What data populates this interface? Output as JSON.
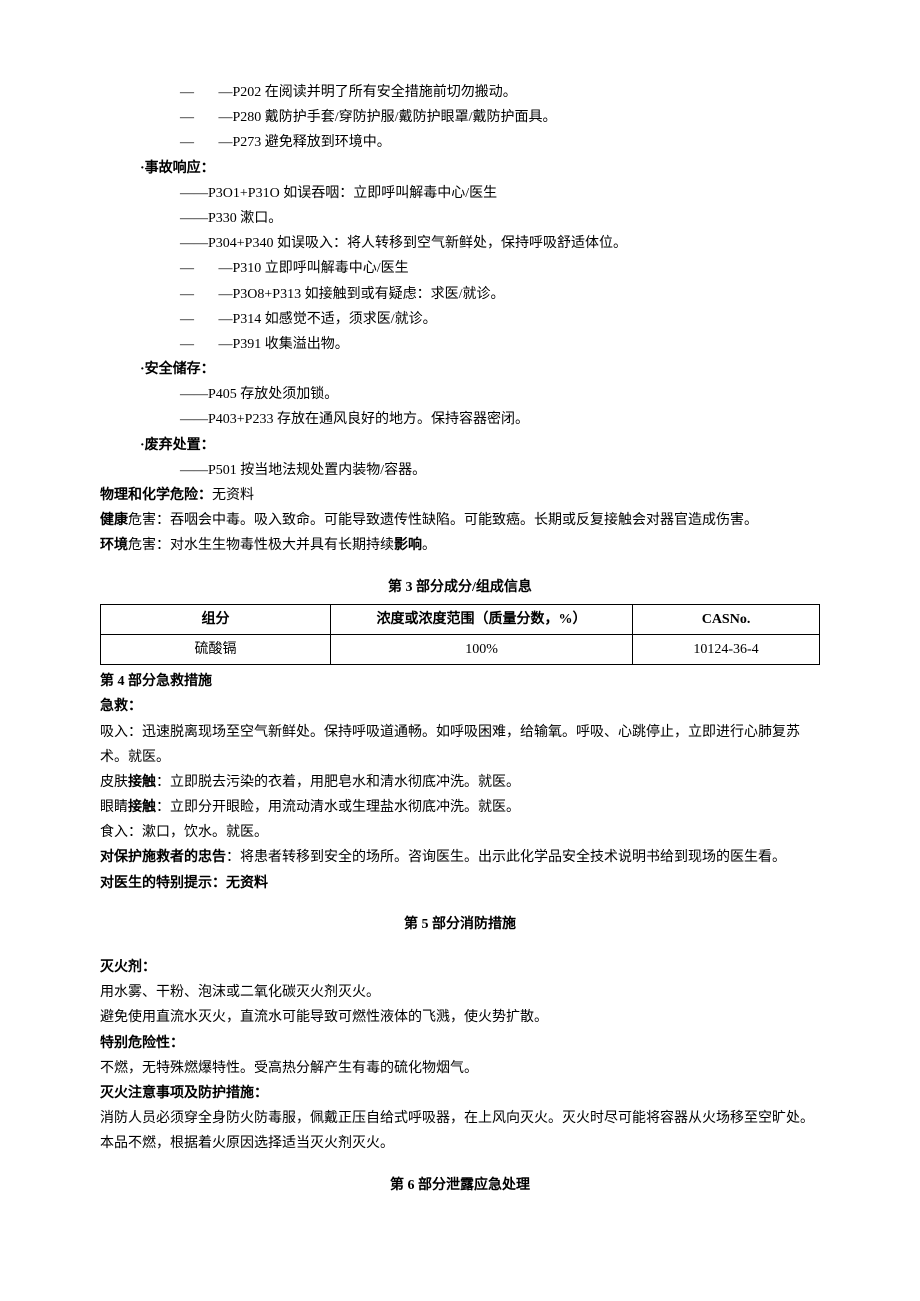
{
  "safety": {
    "p202": "P202 在阅读并明了所有安全措施前切勿搬动。",
    "p280": "P280 戴防护手套/穿防护服/戴防护眼罩/戴防护面具。",
    "p273": "P273 避免释放到环境中。",
    "accident_label": "·事故响应：",
    "p301_310": "P3O1+P31O 如误吞咽：立即呼叫解毒中心/医生",
    "p330": "P330 漱口。",
    "p304_340": "P304+P340 如误吸入：将人转移到空气新鲜处，保持呼吸舒适体位。",
    "p310": "P310 立即呼叫解毒中心/医生",
    "p308_313": "P3O8+P313 如接触到或有疑虑：求医/就诊。",
    "p314": "P314 如感觉不适，须求医/就诊。",
    "p391": "P391 收集溢出物。",
    "storage_label": "·安全储存：",
    "p405": "P405 存放处须加锁。",
    "p403_233": "P403+P233 存放在通风良好的地方。保持容器密闭。",
    "dispose_label": "·废弃处置：",
    "p501": "P501 按当地法规处置内装物/容器。"
  },
  "summary": {
    "phys_label": "物理和化学危险：",
    "phys_text": "无资料",
    "health_label": "健康",
    "health_text": "危害：吞咽会中毒。吸入致命。可能导致遗传性缺陷。可能致癌。长期或反复接触会对器官造成伤害。",
    "env_label": "环境",
    "env_text": "危害：对水生生物毒性极大并具有长期持续",
    "env_bold2": "影响",
    "env_tail": "。"
  },
  "section3": {
    "title": "第 3 部分成分/组成信息",
    "headers": [
      "组分",
      "浓度或浓度范围（质量分数，%）",
      "CASNo."
    ],
    "row": [
      "硫酸镉",
      "100%",
      "10124-36-4"
    ]
  },
  "section4": {
    "title": "第 4 部分急救措施",
    "jijiu": "急救：",
    "xiru": "吸入：迅速脱离现场至空气新鲜处。保持呼吸道通畅。如呼吸困难，给输氧。呼吸、心跳停止，立即进行心肺复苏术。就医。",
    "pifu_pre": "皮肤",
    "pifu_bold": "接触",
    "pifu_post": "：立即脱去污染的衣着，用肥皂水和清水彻底冲洗。就医。",
    "yanjing_pre": "眼睛",
    "yanjing_bold": "接触",
    "yanjing_post": "：立即分开眼睑，用流动清水或生理盐水彻底冲洗。就医。",
    "shiru": "食入：漱口，饮水。就医。",
    "advice_label": "对保护施救者的忠告",
    "advice_text": "：将患者转移到安全的场所。咨询医生。出示此化学品安全技术说明书给到现场的医生看。",
    "doctor_label": "对医生的特别提示：无资料"
  },
  "section5": {
    "title": "第 5 部分消防措施",
    "fire_agent_label": "灭火剂：",
    "fire_agent_text": "用水雾、干粉、泡沫或二氧化碳灭火剂灭火。",
    "avoid": "避免使用直流水灭火，直流水可能导致可燃性液体的飞溅，使火势扩散。",
    "danger_label": "特别危险性：",
    "danger_text": "不燃，无特殊燃爆特性。受高热分解产生有毒的硫化物烟气。",
    "note_label": "灭火注意事项及防护措施：",
    "note_text": "消防人员必须穿全身防火防毒服，佩戴正压自给式呼吸器，在上风向灭火。灭火时尽可能将容器从火场移至空旷处。本品不燃，根据着火原因选择适当灭火剂灭火。"
  },
  "section6": {
    "title": "第 6 部分泄露应急处理"
  }
}
